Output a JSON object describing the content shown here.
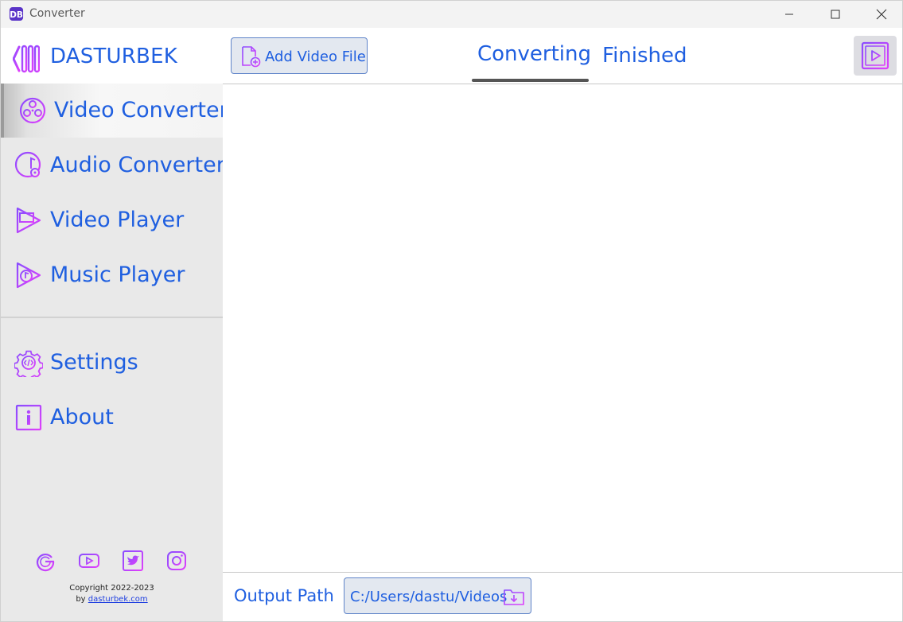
{
  "window": {
    "title": "Converter"
  },
  "brand": {
    "name": "DASTURBEK"
  },
  "sidebar": {
    "items": [
      {
        "label": "Video Converter",
        "icon": "film-reel-icon",
        "active": true
      },
      {
        "label": "Audio Converter",
        "icon": "audio-disc-icon"
      },
      {
        "label": "Video Player",
        "icon": "video-player-icon"
      },
      {
        "label": "Music Player",
        "icon": "music-player-icon"
      }
    ],
    "bottom_items": [
      {
        "label": "Settings",
        "icon": "gear-code-icon"
      },
      {
        "label": "About",
        "icon": "info-icon"
      }
    ],
    "social": [
      "google-icon",
      "youtube-icon",
      "twitter-icon",
      "instagram-icon"
    ],
    "copyright_line": "Copyright 2022-2023",
    "copyright_by": "by ",
    "copyright_link": "dasturbek.com"
  },
  "toolbar": {
    "add_video_label": "Add Video File",
    "tabs": [
      {
        "label": "Converting",
        "active": true
      },
      {
        "label": "Finished"
      }
    ]
  },
  "footer": {
    "output_label": "Output Path",
    "output_path": "C:/Users/dastu/Videos"
  },
  "colors": {
    "accent": "#1f5fe0",
    "icon_gradient_start": "#8a4dff",
    "icon_gradient_end": "#e040fb",
    "sidebar_bg": "#e9e9e9",
    "button_bg": "#e3e8f0",
    "button_border": "#5f84c9"
  }
}
